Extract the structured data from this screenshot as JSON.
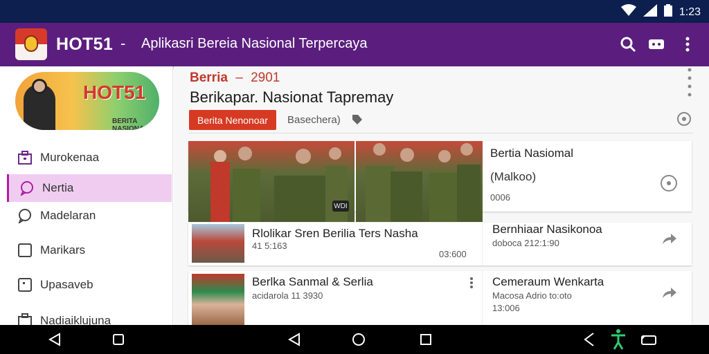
{
  "status": {
    "time": "1:23"
  },
  "app": {
    "name": "HOT51",
    "separator": "-",
    "tagline": "Aplikasri Bereia Nasional Terpercaya"
  },
  "sidebar": {
    "banner_text": "HOT51",
    "banner_subtext": "BERITA NASIONAL",
    "items": [
      {
        "label": "Murokenaa"
      },
      {
        "label": "Nertia"
      },
      {
        "label": "Madelaran"
      },
      {
        "label": "Marikars"
      },
      {
        "label": "Upasaveb"
      },
      {
        "label": "Nadiaiklujuna"
      }
    ]
  },
  "section": {
    "label": "Berria",
    "dash": "–",
    "number": "2901",
    "headline": "Berikapar. Nasionat Tapremay",
    "chip": "Berita Nenonoar",
    "subtext": "Basechera)"
  },
  "featured": {
    "badge": "WDI",
    "title": "Bertia Nasiomal",
    "subtitle": "(Malkoo)",
    "meta": "0006"
  },
  "rows": [
    {
      "title": "Rlolikar Sren Berilia Ters Nasha",
      "meta": "41 5:163",
      "stat": "03:600",
      "side_title": "Bernhiaar Nasikonoa",
      "side_meta": "doboca 212:1:90"
    },
    {
      "title": "Berlka Sanmal & Serlia",
      "meta": "acidarola 11 3930",
      "side_title": "Cemeraum Wenkarta",
      "side_meta": "Macosa Adrio to:oto",
      "side_meta2": "13:006"
    }
  ]
}
